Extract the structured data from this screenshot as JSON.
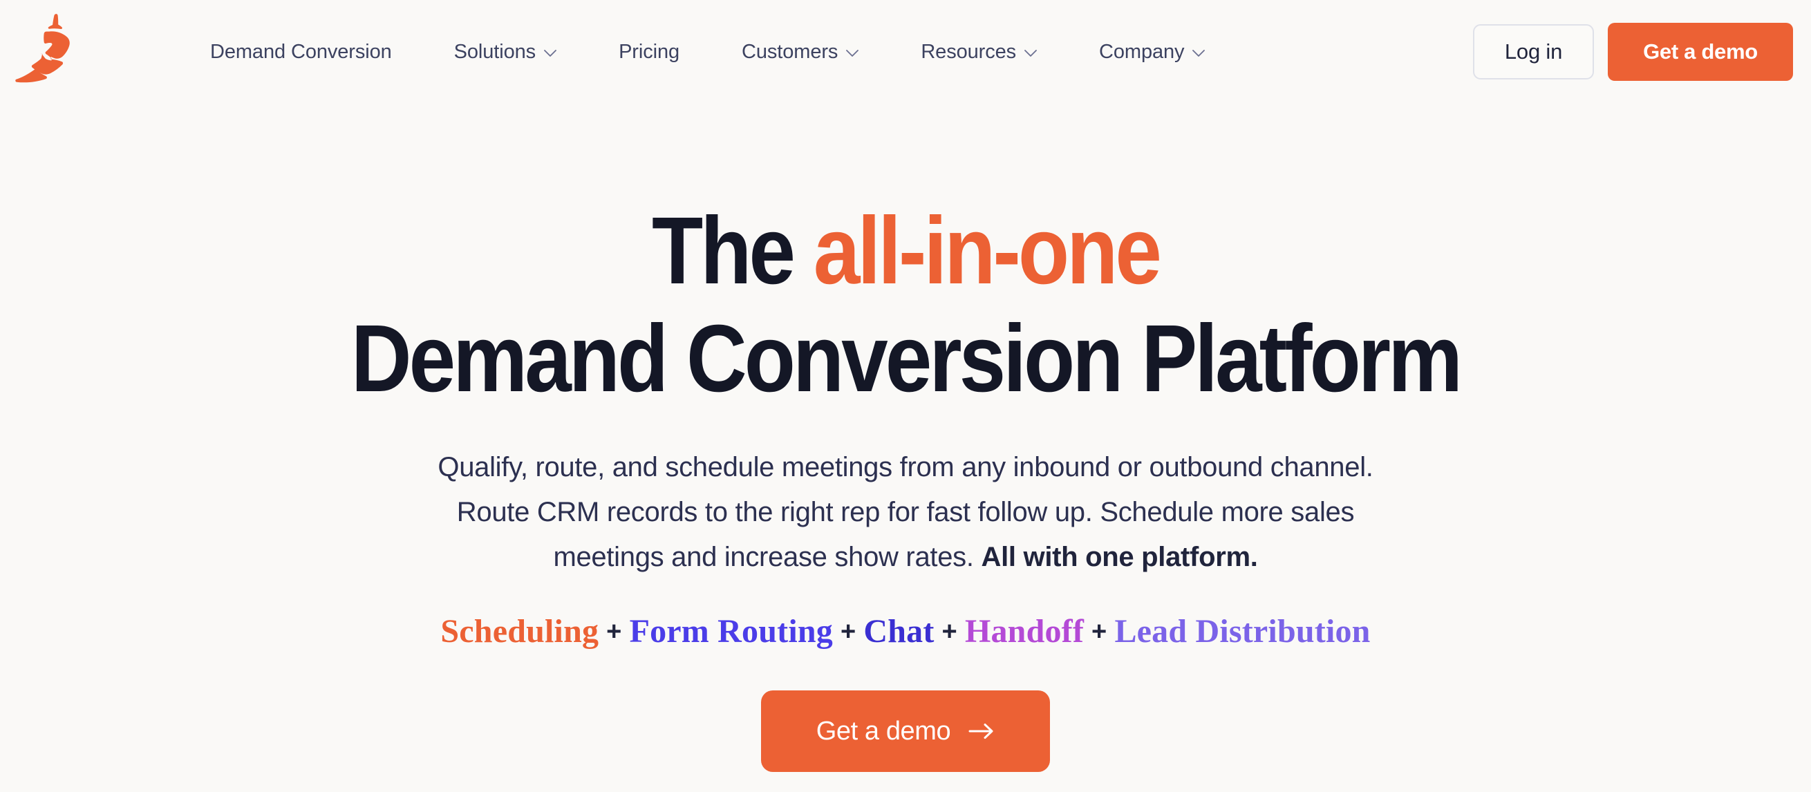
{
  "theme": {
    "page_bg": "#faf9f7",
    "accent_orange": "#ec6134",
    "ink": "#141726",
    "nav_text": "#3c4260",
    "body_text": "#2c3050",
    "login_border": "#dfe1e9"
  },
  "nav": {
    "logo_name": "chili-pepper-logo",
    "logo_color": "#ec6134",
    "items": [
      {
        "label": "Demand Conversion",
        "has_dropdown": false
      },
      {
        "label": "Solutions",
        "has_dropdown": true
      },
      {
        "label": "Pricing",
        "has_dropdown": false
      },
      {
        "label": "Customers",
        "has_dropdown": true
      },
      {
        "label": "Resources",
        "has_dropdown": true
      },
      {
        "label": "Company",
        "has_dropdown": true
      }
    ],
    "login_label": "Log in",
    "demo_label": "Get a demo"
  },
  "hero": {
    "headline_line1_plain": "The ",
    "headline_line1_accent": "all-in-one",
    "headline_line2": "Demand Conversion Platform",
    "subcopy_line1": "Qualify, route, and schedule meetings from any inbound or outbound channel.",
    "subcopy_line2": "Route CRM records to the right rep for fast follow up. Schedule more sales",
    "subcopy_line3_normal": "meetings and increase show rates. ",
    "subcopy_line3_bold": "All with one platform.",
    "features": [
      {
        "label": "Scheduling",
        "color": "#ec6134"
      },
      {
        "label": "Form Routing",
        "color": "#4b3de8"
      },
      {
        "label": "Chat",
        "color": "#3a2fd2"
      },
      {
        "label": "Handoff",
        "color": "#b44ad6"
      },
      {
        "label": "Lead Distribution",
        "color": "#7b63e8"
      }
    ],
    "feature_separator": "+",
    "cta_label": "Get a demo",
    "cta_icon": "arrow-right-icon"
  }
}
